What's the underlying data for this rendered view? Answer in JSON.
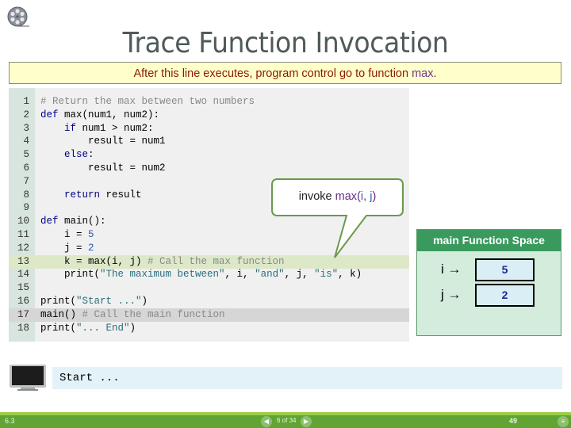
{
  "header": {
    "title": "Trace Function Invocation",
    "banner_prefix": "After this line executes, program control go to function ",
    "banner_highlight": "max",
    "banner_suffix": "."
  },
  "code": {
    "lines": [
      {
        "n": "1",
        "text": "# Return the max between two numbers"
      },
      {
        "n": "2",
        "text": "def max(num1, num2):"
      },
      {
        "n": "3",
        "text": "    if num1 > num2:"
      },
      {
        "n": "4",
        "text": "        result = num1"
      },
      {
        "n": "5",
        "text": "    else:"
      },
      {
        "n": "6",
        "text": "        result = num2"
      },
      {
        "n": "7",
        "text": ""
      },
      {
        "n": "8",
        "text": "    return result"
      },
      {
        "n": "9",
        "text": ""
      },
      {
        "n": "10",
        "text": "def main():"
      },
      {
        "n": "11",
        "text": "    i = 5"
      },
      {
        "n": "12",
        "text": "    j = 2"
      },
      {
        "n": "13",
        "text": "    k = max(i, j) # Call the max function"
      },
      {
        "n": "14",
        "text": "    print(\"The maximum between\", i, \"and\", j, \"is\", k)"
      },
      {
        "n": "15",
        "text": ""
      },
      {
        "n": "16",
        "text": "print(\"Start ...\")"
      },
      {
        "n": "17",
        "text": "main() # Call the main function"
      },
      {
        "n": "18",
        "text": "print(\"... End\")"
      }
    ],
    "current_line": 13,
    "caller_line": 17
  },
  "callout": {
    "prefix": "invoke ",
    "func": "max",
    "open": "(",
    "arg1": "i",
    "sep": ", ",
    "arg2": "j",
    "close": ")"
  },
  "function_space": {
    "title": "main Function Space",
    "vars": [
      {
        "name": "i",
        "arrow": "→",
        "value": "5"
      },
      {
        "name": "j",
        "arrow": "→",
        "value": "2"
      }
    ]
  },
  "console": {
    "output": "Start ..."
  },
  "footer": {
    "section": "6.3",
    "page_indicator": "6 of 34",
    "prev_icon": "◀",
    "next_icon": "▶",
    "slide_number": "49",
    "menu_icon": "≡"
  },
  "colors": {
    "banner_bg": "#ffffcc",
    "banner_text": "#8b1a00",
    "current_line_bg": "#dde8c8",
    "caller_line_bg": "#d6d6d6",
    "function_space_header": "#3a9a5e",
    "footer_bg": "#62a434"
  }
}
